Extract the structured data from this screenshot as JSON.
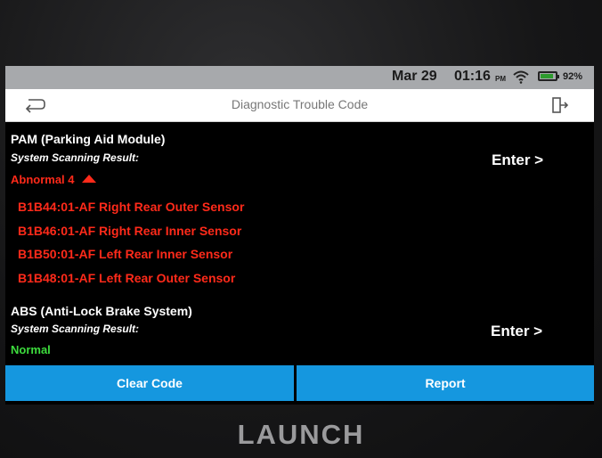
{
  "statusbar": {
    "date": "Mar 29",
    "time": "01:16",
    "ampm": "PM",
    "battery_pct": "92%",
    "wifi_icon": "wifi-icon",
    "battery_icon": "battery-icon"
  },
  "titlebar": {
    "title": "Diagnostic Trouble Code",
    "back_icon": "back-arrow-icon",
    "exit_icon": "exit-icon"
  },
  "modules": [
    {
      "name": "PAM (Parking Aid Module)",
      "scan_label": "System Scanning Result:",
      "enter_label": "Enter >",
      "status": "Abnormal 4",
      "status_icon": "warning-triangle-icon",
      "codes": [
        "B1B44:01-AF Right Rear Outer Sensor",
        "B1B46:01-AF Right Rear Inner Sensor",
        "B1B50:01-AF Left Rear Inner Sensor",
        "B1B48:01-AF Left Rear Outer Sensor"
      ]
    },
    {
      "name": "ABS (Anti-Lock Brake System)",
      "scan_label": "System Scanning Result:",
      "enter_label": "Enter >",
      "status": "Normal"
    }
  ],
  "buttons": {
    "clear_code": "Clear Code",
    "report": "Report"
  },
  "device": {
    "brand": "LAUNCH"
  },
  "colors": {
    "accent": "#1597df",
    "error": "#ff2a1a",
    "ok": "#3ddc3d",
    "statusbar": "#a7a9ac"
  }
}
